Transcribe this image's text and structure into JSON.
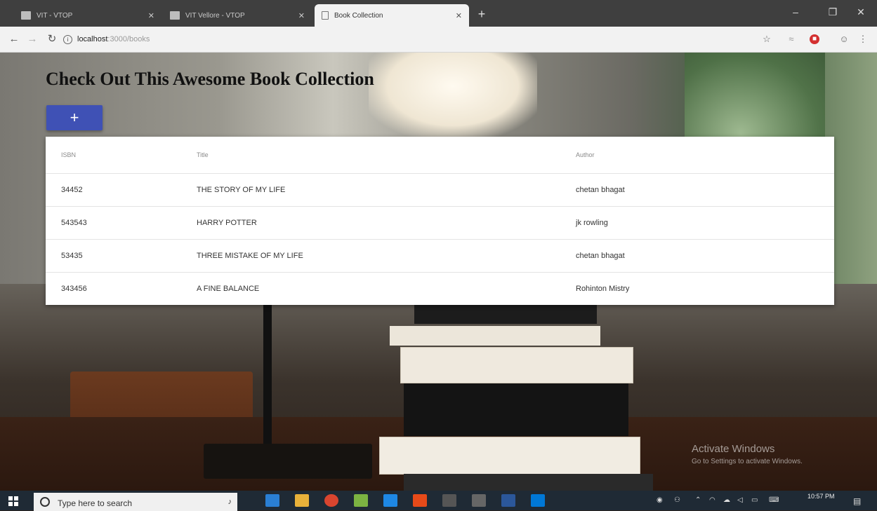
{
  "browser": {
    "tabs": [
      {
        "title": "VIT - VTOP",
        "active": false
      },
      {
        "title": "VIT Vellore - VTOP",
        "active": false
      },
      {
        "title": "Book Collection",
        "active": true
      }
    ],
    "url_host": "localhost",
    "url_path": ":3000/books"
  },
  "page": {
    "title": "Check Out This Awesome Book Collection",
    "add_button_label": "+"
  },
  "table": {
    "columns": [
      "ISBN",
      "Title",
      "Author"
    ],
    "rows": [
      [
        "34452",
        "THE STORY OF MY LIFE",
        "chetan bhagat"
      ],
      [
        "543543",
        "HARRY POTTER",
        "jk rowling"
      ],
      [
        "53435",
        "THREE MISTAKE OF MY LIFE",
        "chetan bhagat"
      ],
      [
        "343456",
        "A FINE BALANCE",
        "Rohinton Mistry"
      ]
    ]
  },
  "watermark": {
    "line1": "Activate Windows",
    "line2": "Go to Settings to activate Windows."
  },
  "taskbar": {
    "search_placeholder": "Type here to search",
    "clock_time": "10:57 PM"
  },
  "colors": {
    "primary_button": "#3f51b5",
    "taskbar": "#1f2a35"
  }
}
